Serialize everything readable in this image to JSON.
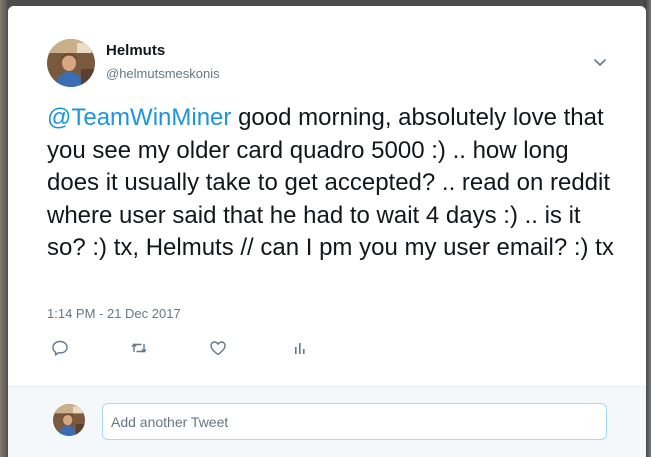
{
  "tweet": {
    "author_name": "Helmuts",
    "author_handle": "@helmutsmeskonis",
    "mention": "@TeamWinMiner",
    "body": " good morning, absolutely love that you see my older card quadro 5000 :) .. how long does it usually take to get accepted? .. read on reddit where user said that he had to wait 4 days :) .. is it so? :) tx, Helmuts // can I pm you my user email? :) tx",
    "timestamp": "1:14 PM - 21 Dec 2017"
  },
  "actions": {
    "icons": [
      "reply-icon",
      "retweet-icon",
      "like-icon",
      "analytics-icon"
    ]
  },
  "reply": {
    "placeholder": "Add another Tweet"
  },
  "colors": {
    "accent": "#1b95e0",
    "text": "#14171a",
    "secondary": "#657786",
    "input_border": "#a4d9f9",
    "reply_bg": "#f5f8fa"
  }
}
